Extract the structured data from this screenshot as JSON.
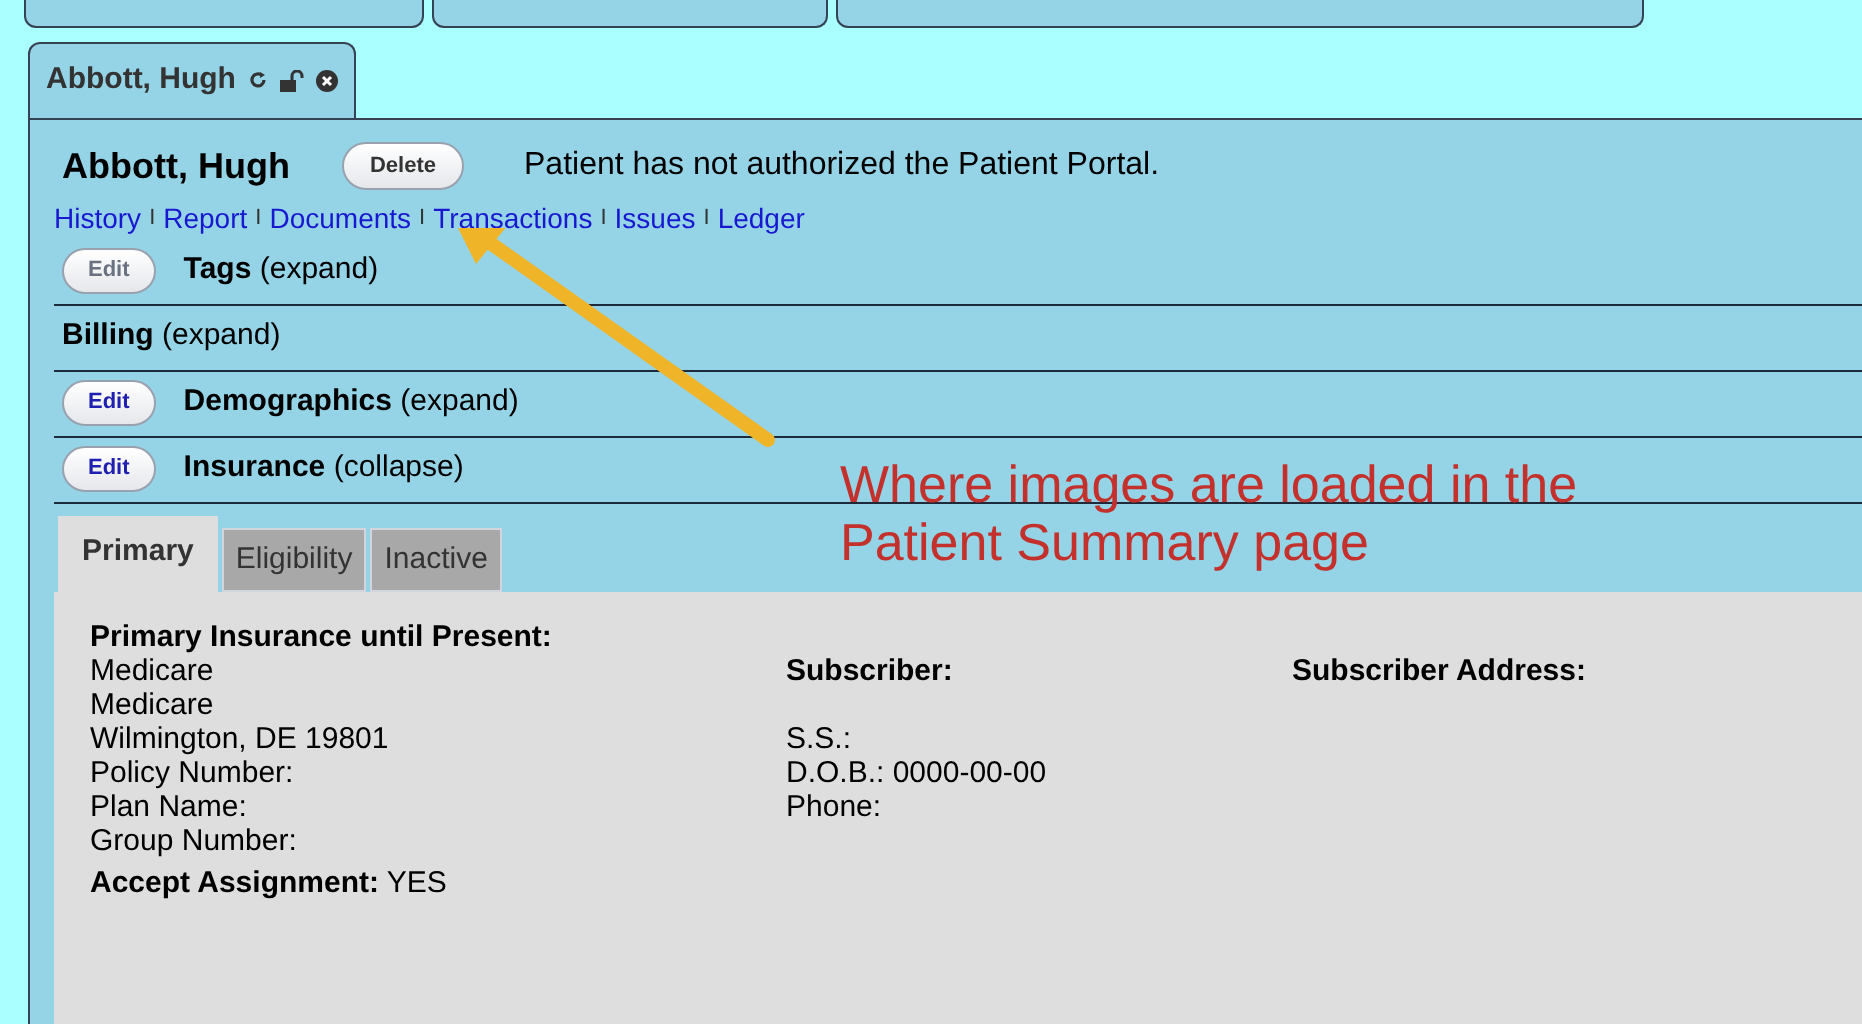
{
  "patient_tab": {
    "label": "Abbott, Hugh",
    "selected": true
  },
  "header": {
    "name": "Abbott, Hugh",
    "delete_button": "Delete",
    "portal_message": "Patient has not authorized the Patient Portal."
  },
  "nav_links": [
    {
      "label": "History"
    },
    {
      "separator": "I",
      "label": "Report"
    },
    {
      "separator": "I",
      "label": "Documents"
    },
    {
      "separator": "I",
      "label": "Transactions"
    },
    {
      "separator": "I",
      "label": "Issues"
    },
    {
      "separator": "I",
      "label": "Ledger"
    }
  ],
  "sections": [
    {
      "title": "Tags",
      "toggle": "(expand)",
      "edit": {
        "label": "Edit",
        "disabled": true
      },
      "expanded": false
    },
    {
      "title": "Billing",
      "toggle": "(expand)",
      "expanded": false
    },
    {
      "title": "Demographics",
      "toggle": "(expand)",
      "edit": {
        "label": "Edit",
        "disabled": false
      },
      "expanded": false
    },
    {
      "title": "Insurance",
      "toggle": "(collapse)",
      "edit": {
        "label": "Edit",
        "disabled": false
      },
      "expanded": true
    }
  ],
  "insurance_tabs": [
    {
      "label": "Primary",
      "selected": true
    },
    {
      "label": "Eligibility",
      "selected": false
    },
    {
      "label": "Inactive",
      "selected": false
    }
  ],
  "insurance": {
    "heading": "Primary Insurance until Present:",
    "details": [
      "Medicare",
      "Medicare",
      "Wilmington, DE 19801",
      "Policy Number:",
      "Plan Name:",
      "Group Number:"
    ],
    "accept_label": "Accept Assignment:",
    "accept_value": "YES",
    "subscriber_heading": "Subscriber:",
    "subscriber_lines": [
      "S.S.:",
      "D.O.B.: 0000-00-00",
      "Phone:"
    ],
    "address_heading": "Subscriber Address:"
  },
  "annotation": "Where images are loaded in the Patient Summary page"
}
